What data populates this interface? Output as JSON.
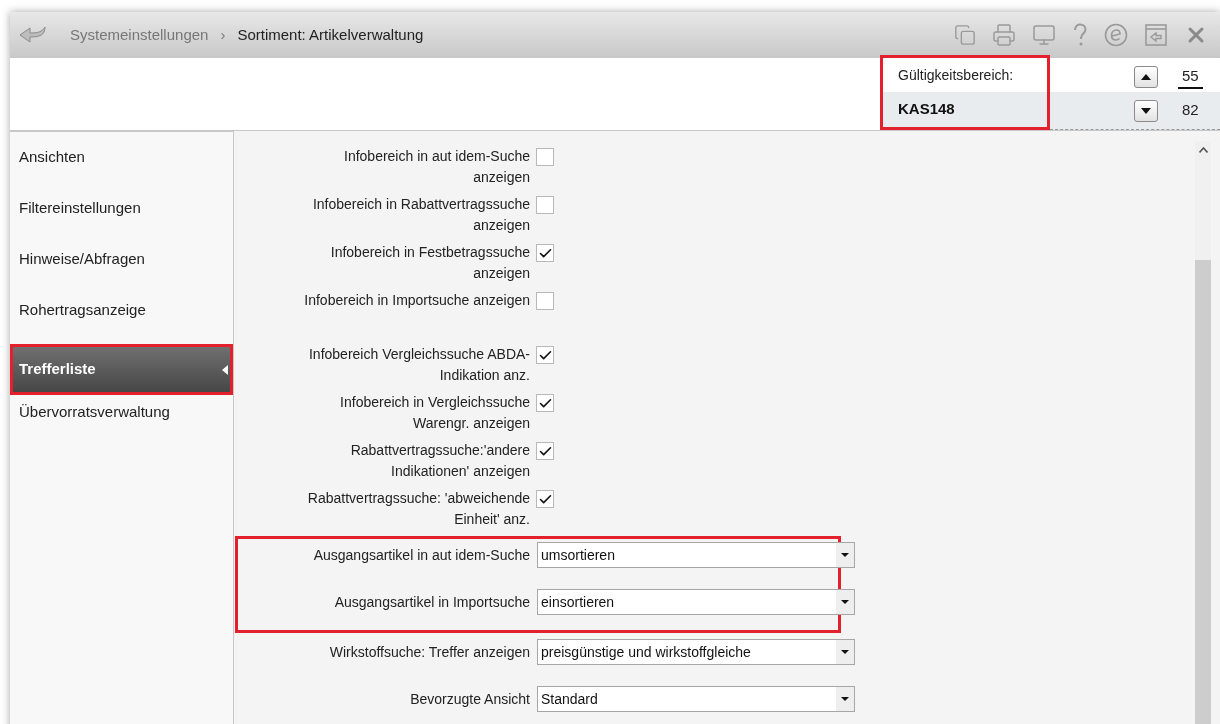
{
  "title_bar": {
    "breadcrumb": [
      {
        "label": "Systemeinstellungen",
        "current": false
      },
      {
        "label": "Sortiment: Artikelverwaltung",
        "current": true
      }
    ],
    "separator": "›"
  },
  "scope": {
    "label": "Gültigkeitsbereich:",
    "value": "KAS148",
    "highlighted": true
  },
  "counter": {
    "upper": "55",
    "lower": "82"
  },
  "sidebar": {
    "items": [
      {
        "label": "Ansichten",
        "selected": false,
        "highlighted": false
      },
      {
        "label": "Filtereinstellungen",
        "selected": false,
        "highlighted": false
      },
      {
        "label": "Hinweise/Abfragen",
        "selected": false,
        "highlighted": false
      },
      {
        "label": "Rohertragsanzeige",
        "selected": false,
        "highlighted": false
      },
      {
        "label": "Trefferliste",
        "selected": true,
        "highlighted": true
      },
      {
        "label": "Übervorratsverwaltung",
        "selected": false,
        "highlighted": false
      }
    ]
  },
  "settings": [
    {
      "kind": "checkbox",
      "label": "Infobereich in aut idem-Suche anzeigen",
      "checked": false
    },
    {
      "kind": "checkbox",
      "label": "Infobereich in Rabattvertragssuche anzeigen",
      "checked": false
    },
    {
      "kind": "checkbox",
      "label": "Infobereich in Festbetragssuche anzeigen",
      "checked": true
    },
    {
      "kind": "checkbox",
      "label": "Infobereich in Importsuche anzeigen",
      "checked": false
    },
    {
      "kind": "checkbox",
      "label": "Infobereich Vergleichssuche ABDA-Indikation anz.",
      "checked": true
    },
    {
      "kind": "checkbox",
      "label": "Infobereich in Vergleichssuche Warengr. anzeigen",
      "checked": true
    },
    {
      "kind": "checkbox",
      "label": "Rabattvertragssuche:'andere Indikationen' anzeigen",
      "checked": true
    },
    {
      "kind": "checkbox",
      "label": "Rabattvertragssuche: 'abweichende Einheit' anz.",
      "checked": true
    },
    {
      "kind": "dropdown",
      "label": "Ausgangsartikel in aut idem-Suche",
      "value": "umsortieren",
      "highlighted": true
    },
    {
      "kind": "dropdown",
      "label": "Ausgangsartikel in Importsuche",
      "value": "einsortieren",
      "highlighted": true
    },
    {
      "kind": "dropdown",
      "label": "Wirkstoffsuche: Treffer anzeigen",
      "value": "preisgünstige und wirkstoffgleiche",
      "highlighted": false
    },
    {
      "kind": "dropdown",
      "label": "Bevorzugte Ansicht",
      "value": "Standard",
      "highlighted": false
    }
  ]
}
